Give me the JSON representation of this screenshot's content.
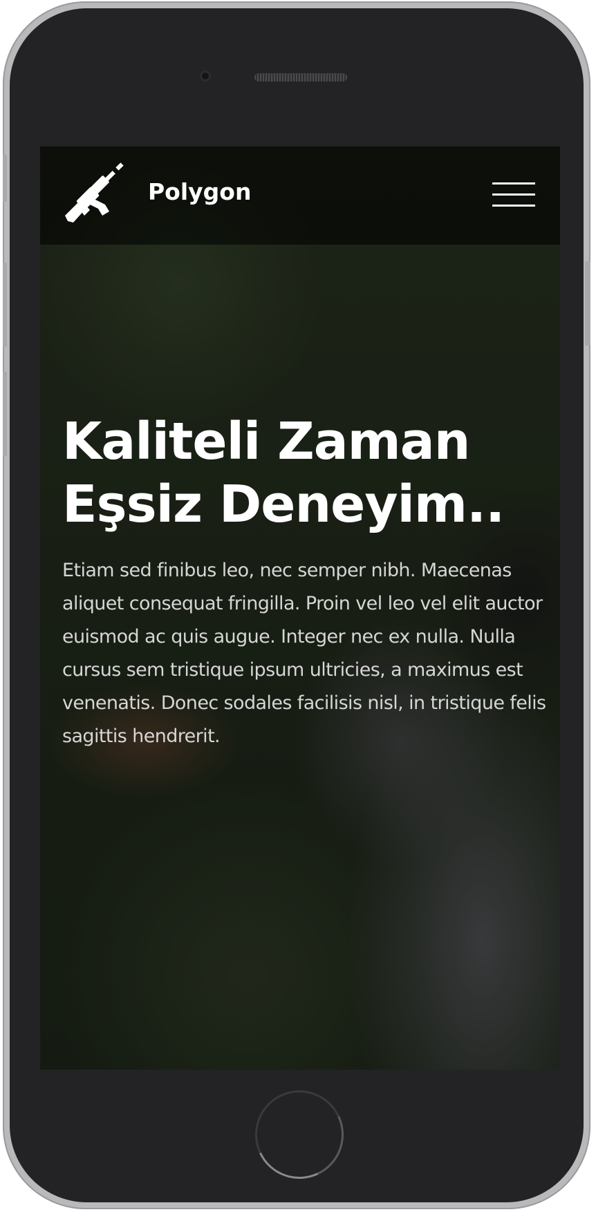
{
  "navbar": {
    "brand": "Polygon",
    "logo_icon": "rifle-icon",
    "menu_icon": "hamburger-menu-icon"
  },
  "hero": {
    "title_line_1": "Kaliteli Zaman",
    "title_line_2": "Eşsiz Deneyim..",
    "text": "Etiam sed finibus leo, nec semper nibh. Maecenas aliquet consequat fringilla. Proin vel leo vel elit auctor euismod ac quis augue. Integer nec ex nulla. Nulla cursus sem tristique ipsum ultricies, a maximus est venenatis. Donec sodales facilisis nisl, in tristique felis sagittis hendrerit."
  },
  "colors": {
    "phone_frame": "#b9b9bb",
    "phone_body": "#232325",
    "text_primary": "#ffffff",
    "text_secondary": "#d6d6d6"
  }
}
